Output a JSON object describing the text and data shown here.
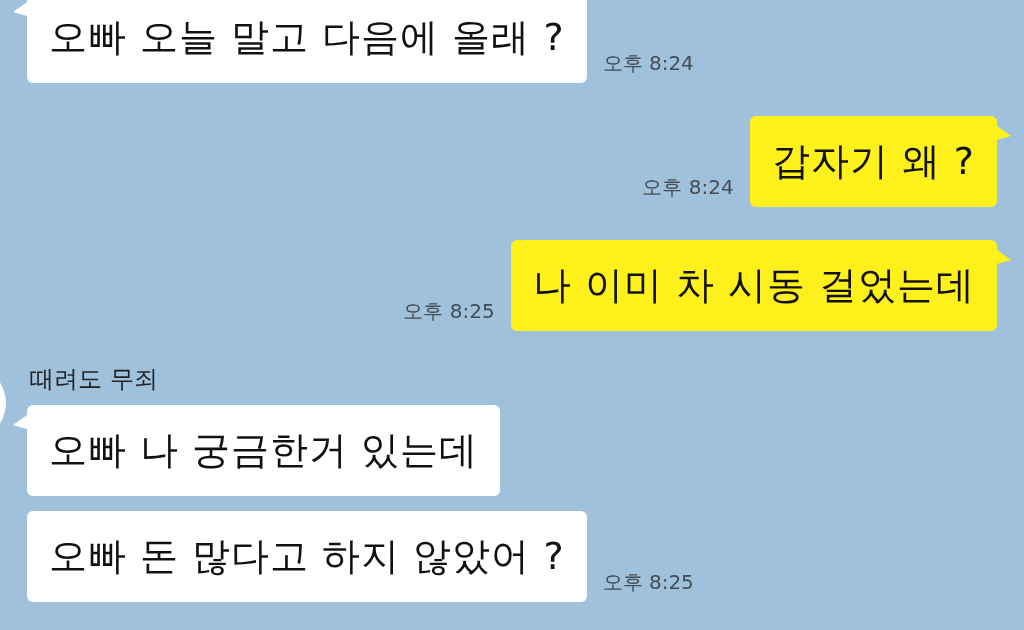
{
  "messages": [
    {
      "kind": "incoming",
      "avatar": false,
      "tail": true,
      "text": "오빠 오늘 말고 다음에 올래 ?",
      "time": "오후 8:24"
    },
    {
      "kind": "outgoing",
      "tail": true,
      "text": "갑자기 왜 ?",
      "time": "오후 8:24"
    },
    {
      "kind": "outgoing",
      "tail": true,
      "text": "나 이미 차 시동 걸었는데",
      "time": "오후 8:25"
    },
    {
      "kind": "incoming",
      "sender": "때려도 무죄",
      "avatar": true,
      "tail": true,
      "text": "오빠 나 궁금한거 있는데"
    },
    {
      "kind": "incoming",
      "avatar": false,
      "tail": false,
      "text": "오빠 돈 많다고 하지 않았어 ?",
      "time": "오후 8:25"
    }
  ]
}
